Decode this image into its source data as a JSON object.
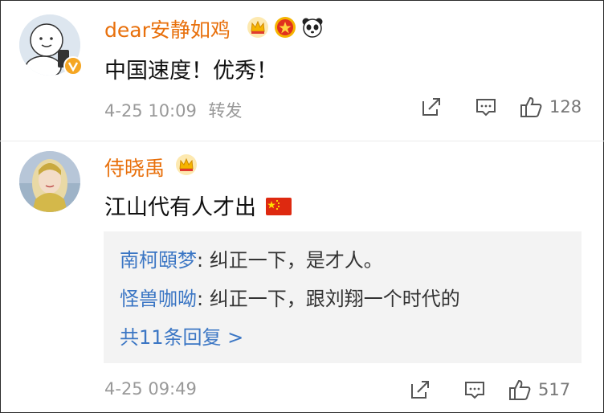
{
  "comments": [
    {
      "username": "dear安静如鸡",
      "text": "中国速度！优秀！",
      "time": "4-25 10:09",
      "forward_label": "转发",
      "likes": "128",
      "badges": [
        "crown-badge-icon",
        "star-medal-badge-icon",
        "panda-badge-icon"
      ],
      "verified": true
    },
    {
      "username": "侍晓禹",
      "text": "江山代有人才出",
      "time": "4-25 09:49",
      "likes": "517",
      "badges": [
        "crown-badge-icon",
        "china-flag-emoji-icon"
      ],
      "replies": [
        {
          "user": "南柯頤梦",
          "sep": ": ",
          "text": "纠正一下，是才人。"
        },
        {
          "user": "怪兽咖呦",
          "sep": ": ",
          "text": "纠正一下，跟刘翔一个时代的"
        }
      ],
      "more_replies": "共11条回复 >"
    }
  ],
  "colors": {
    "username": "#e8700c",
    "reply_user": "#3b76c4",
    "meta": "#999999",
    "reply_bg": "#f3f3f3"
  }
}
